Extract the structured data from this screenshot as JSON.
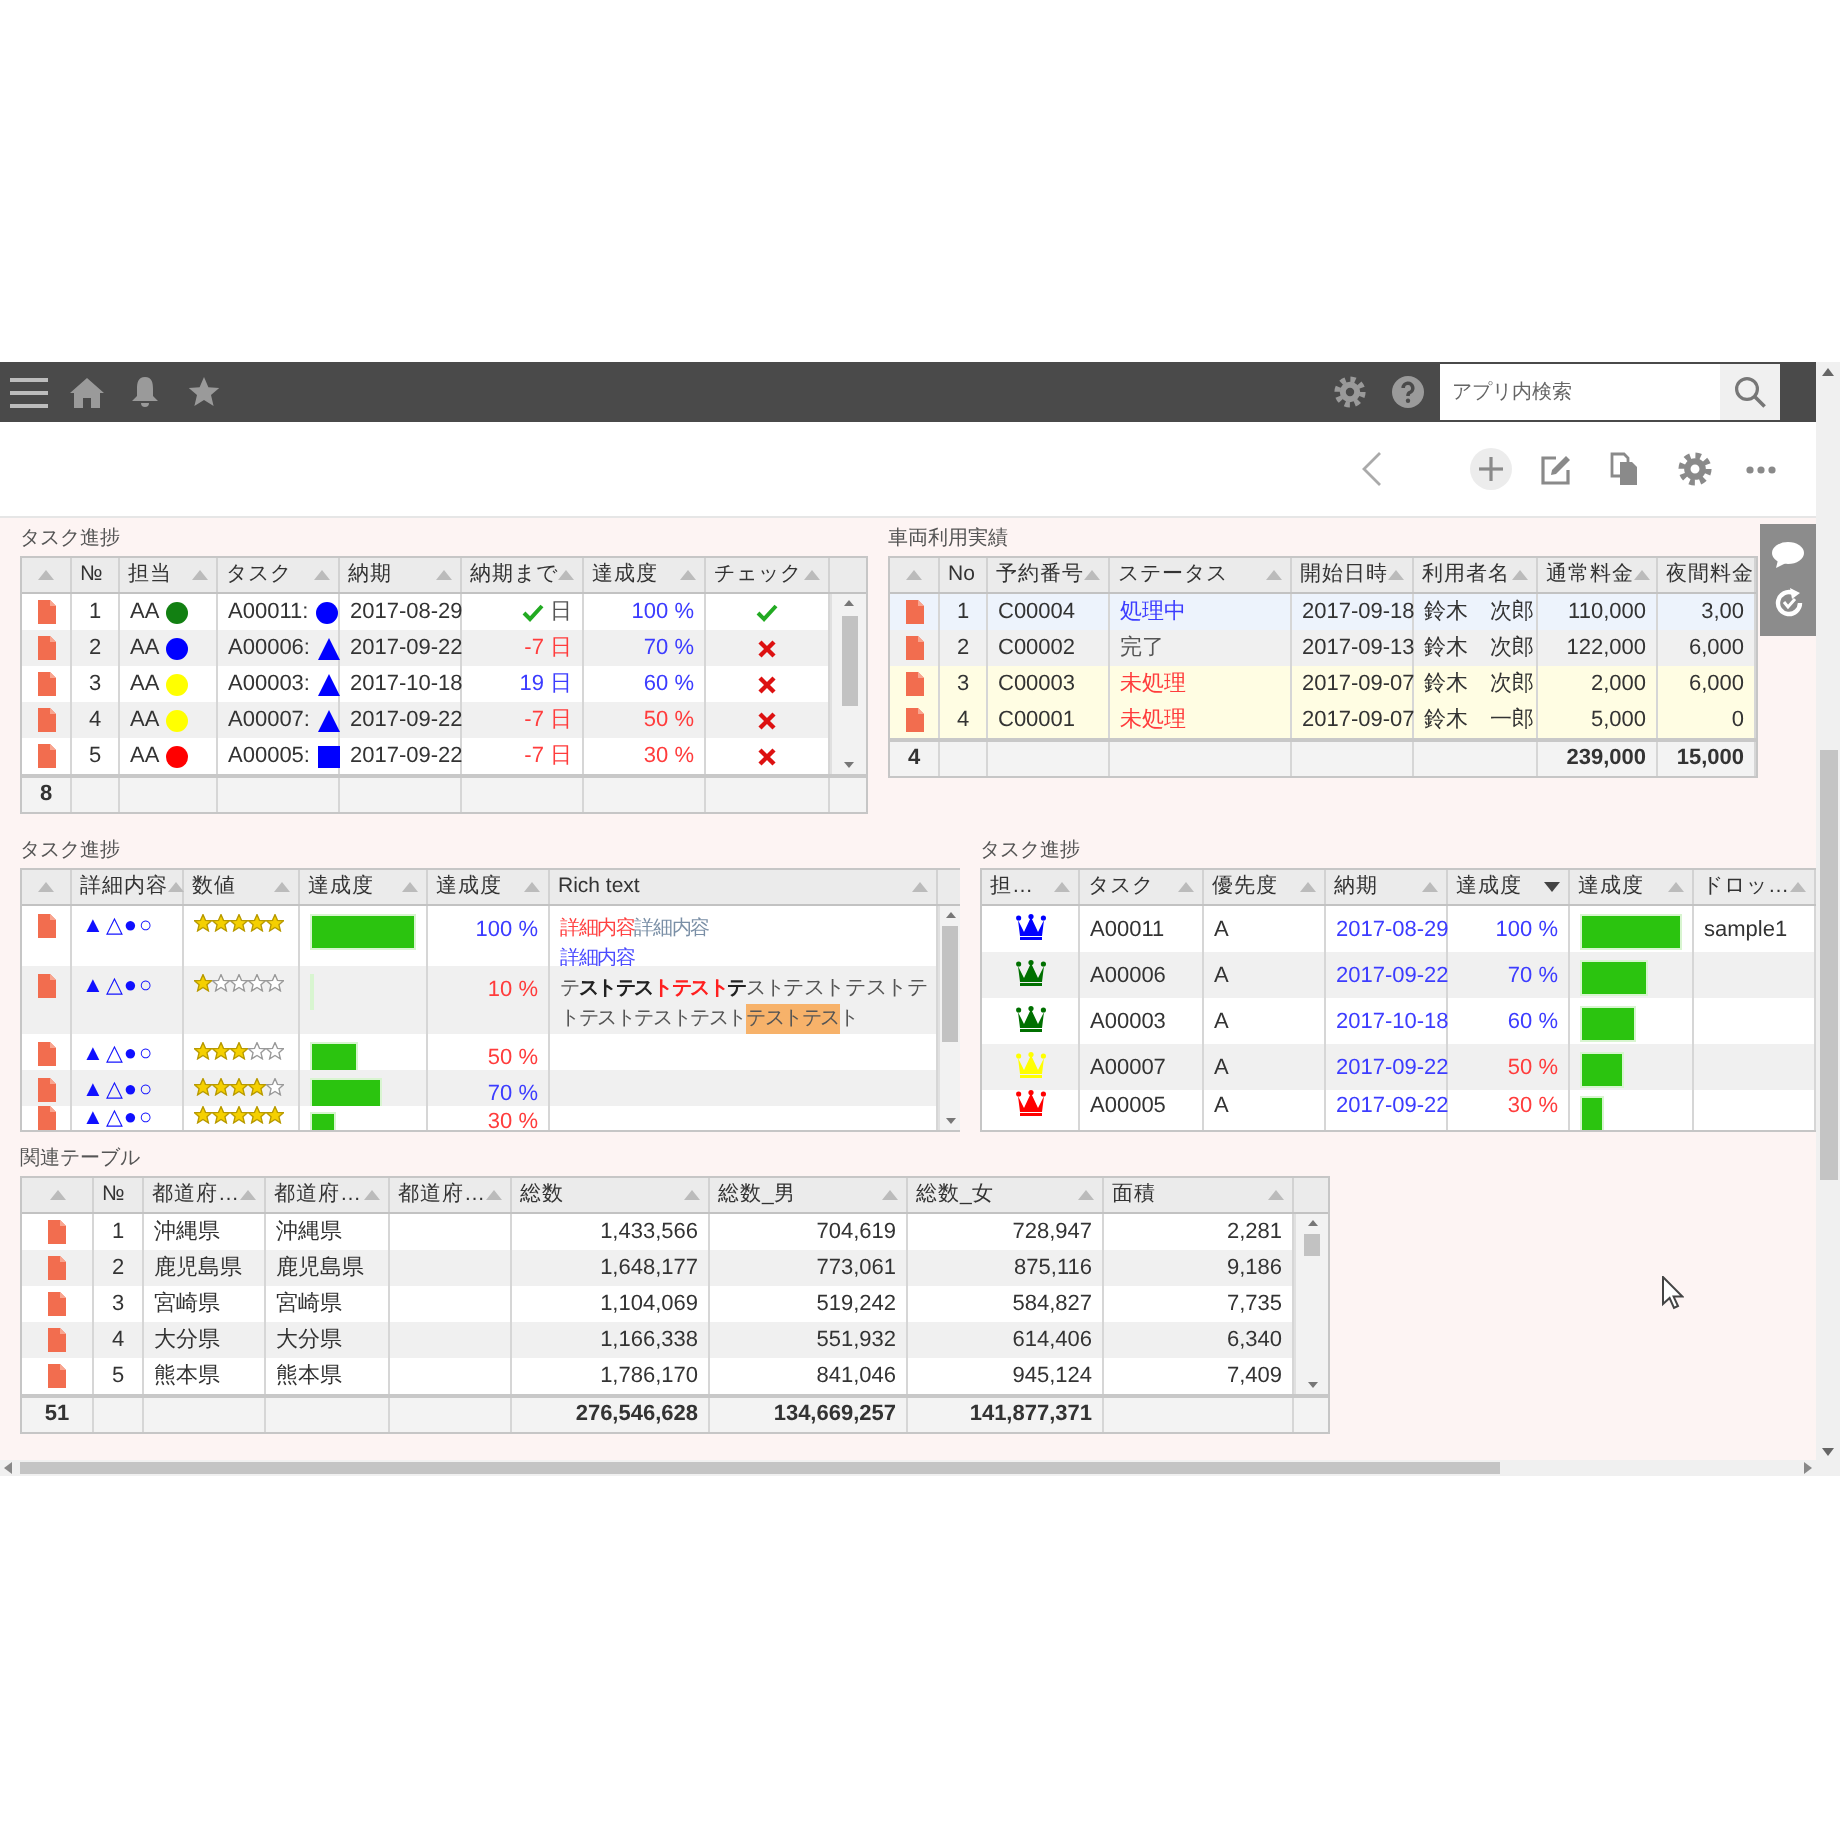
{
  "app_bar": {
    "search": {
      "placeholder": "アプリ内検索"
    }
  },
  "panels": [
    {
      "title": "タスク進捗",
      "footer_count": "8",
      "columns": [
        {
          "sortable": true
        },
        {
          "label": "№",
          "sortable": false
        },
        {
          "label": "担当",
          "sortable": true
        },
        {
          "label": "タスク",
          "sortable": true
        },
        {
          "label": "納期",
          "sortable": true
        },
        {
          "label": "納期まで",
          "sortable": true
        },
        {
          "label": "達成度",
          "sortable": true
        },
        {
          "label": "チェック",
          "sortable": true
        }
      ],
      "rows": [
        {
          "cells": [
            {
              "kind": "doc"
            },
            {
              "kind": "index",
              "text": "1"
            },
            {
              "kind": "assignee",
              "text": "AA",
              "color": "#128012"
            },
            {
              "kind": "task",
              "text": "A00011:",
              "icon": {
                "kind": "circle"
              }
            },
            {
              "kind": "text",
              "text": "2017-08-29"
            },
            {
              "kind": "days",
              "text": "日",
              "met": true
            },
            {
              "kind": "amount",
              "text": "100 %",
              "color": "#3c3cff"
            },
            {
              "kind": "check",
              "checked": true
            }
          ]
        },
        {
          "cells": [
            {
              "kind": "doc"
            },
            {
              "kind": "index",
              "text": "2"
            },
            {
              "kind": "assignee",
              "text": "AA",
              "color": "#0000ff"
            },
            {
              "kind": "task",
              "text": "A00006:",
              "icon": {
                "kind": "triangle"
              }
            },
            {
              "kind": "text",
              "text": "2017-09-22"
            },
            {
              "kind": "days",
              "text": "-7 日",
              "met": false,
              "color": "#ff3c3c"
            },
            {
              "kind": "amount",
              "text": "70 %",
              "color": "#3c3cff"
            },
            {
              "kind": "check",
              "checked": false
            }
          ]
        },
        {
          "cells": [
            {
              "kind": "doc"
            },
            {
              "kind": "index",
              "text": "3"
            },
            {
              "kind": "assignee",
              "text": "AA",
              "color": "#ffff00"
            },
            {
              "kind": "task",
              "text": "A00003:",
              "icon": {
                "kind": "triangle"
              }
            },
            {
              "kind": "text",
              "text": "2017-10-18"
            },
            {
              "kind": "days",
              "text": "19 日",
              "met": false,
              "color": "#3c3cff"
            },
            {
              "kind": "amount",
              "text": "60 %",
              "color": "#3c3cff"
            },
            {
              "kind": "check",
              "checked": false
            }
          ]
        },
        {
          "cells": [
            {
              "kind": "doc"
            },
            {
              "kind": "index",
              "text": "4"
            },
            {
              "kind": "assignee",
              "text": "AA",
              "color": "#ffff00"
            },
            {
              "kind": "task",
              "text": "A00007:",
              "icon": {
                "kind": "triangle"
              }
            },
            {
              "kind": "text",
              "text": "2017-09-22"
            },
            {
              "kind": "days",
              "text": "-7 日",
              "met": false,
              "color": "#ff3c3c"
            },
            {
              "kind": "amount",
              "text": "50 %",
              "color": "#ff3c3c"
            },
            {
              "kind": "check",
              "checked": false
            }
          ]
        },
        {
          "cells": [
            {
              "kind": "doc"
            },
            {
              "kind": "index",
              "text": "5"
            },
            {
              "kind": "assignee",
              "text": "AA",
              "color": "#ff0000"
            },
            {
              "kind": "task",
              "text": "A00005:",
              "icon": {
                "kind": "square"
              }
            },
            {
              "kind": "text",
              "text": "2017-09-22"
            },
            {
              "kind": "days",
              "text": "-7 日",
              "met": false,
              "color": "#ff3c3c"
            },
            {
              "kind": "amount",
              "text": "30 %",
              "color": "#ff3c3c"
            },
            {
              "kind": "check",
              "checked": false
            }
          ]
        }
      ]
    },
    {
      "title": "車両利用実績",
      "footer_count": "4",
      "columns": [
        {
          "sortable": true
        },
        {
          "label": "No",
          "sortable": false
        },
        {
          "label": "予約番号",
          "sortable": true
        },
        {
          "label": "ステータス",
          "sortable": true
        },
        {
          "label": "開始日時",
          "sortable": true
        },
        {
          "label": "利用者名",
          "sortable": true
        },
        {
          "label": "通常料金",
          "sortable": true,
          "total": "239,000"
        },
        {
          "label": "夜間料金",
          "total": "15,000"
        }
      ],
      "rows": [
        {
          "selected": true,
          "cells": [
            {
              "kind": "doc"
            },
            {
              "kind": "index",
              "text": "1"
            },
            {
              "kind": "text",
              "text": "C00004"
            },
            {
              "kind": "text",
              "text": "処理中",
              "color": "#3c3cff"
            },
            {
              "kind": "text",
              "text": "2017-09-18"
            },
            {
              "kind": "text",
              "text": "鈴木　次郎"
            },
            {
              "kind": "amount",
              "text": "110,000"
            },
            {
              "kind": "amount",
              "text": "3,00"
            }
          ]
        },
        {
          "selected": false,
          "cells": [
            {
              "kind": "doc"
            },
            {
              "kind": "index",
              "text": "2"
            },
            {
              "kind": "text",
              "text": "C00002"
            },
            {
              "kind": "text",
              "text": "完了",
              "color": "#555555"
            },
            {
              "kind": "text",
              "text": "2017-09-13"
            },
            {
              "kind": "text",
              "text": "鈴木　次郎"
            },
            {
              "kind": "amount",
              "text": "122,000"
            },
            {
              "kind": "amount",
              "text": "6,000"
            }
          ]
        },
        {
          "selected": false,
          "color": "#fffde3",
          "cells": [
            {
              "kind": "doc"
            },
            {
              "kind": "index",
              "text": "3"
            },
            {
              "kind": "text",
              "text": "C00003"
            },
            {
              "kind": "text",
              "text": "未処理",
              "color": "#ff3c3c"
            },
            {
              "kind": "text",
              "text": "2017-09-07"
            },
            {
              "kind": "text",
              "text": "鈴木　次郎"
            },
            {
              "kind": "amount",
              "text": "2,000"
            },
            {
              "kind": "amount",
              "text": "6,000"
            }
          ]
        },
        {
          "selected": false,
          "color": "#fffde3",
          "cells": [
            {
              "kind": "doc"
            },
            {
              "kind": "index",
              "text": "4"
            },
            {
              "kind": "text",
              "text": "C00001"
            },
            {
              "kind": "text",
              "text": "未処理",
              "color": "#ff3c3c"
            },
            {
              "kind": "text",
              "text": "2017-09-07"
            },
            {
              "kind": "text",
              "text": "鈴木　一郎"
            },
            {
              "kind": "amount",
              "text": "5,000"
            },
            {
              "kind": "amount",
              "text": "0"
            }
          ]
        }
      ]
    },
    {
      "title": "タスク進捗",
      "columns": [
        {
          "sortable": true
        },
        {
          "label": "詳細内容",
          "sortable": true
        },
        {
          "label": "数値",
          "sortable": true
        },
        {
          "label": "達成度",
          "sortable": true
        },
        {
          "label": "達成度",
          "sortable": true
        },
        {
          "label": "Rich text",
          "sortable": true
        }
      ],
      "rows": [
        {
          "cells": [
            {
              "kind": "doc"
            },
            {
              "kind": "glyphs",
              "text": "▲△●○"
            },
            {
              "kind": "stars",
              "stars": 5
            },
            {
              "kind": "bar",
              "level": 1
            },
            {
              "kind": "amount",
              "text": "100 %",
              "color": "#3c3cff"
            },
            {
              "kind": "rich",
              "lines": [
                [
                  {
                    "text": "詳細内容",
                    "color": "#ff4040",
                    "bold": false,
                    "large": false,
                    "highlighted": false
                  },
                  {
                    "text": "詳細内容",
                    "color": "#7a8fa6",
                    "bold": false,
                    "large": false,
                    "highlighted": false
                  }
                ],
                [
                  {
                    "text": "詳細内容",
                    "color": "#4a4aff",
                    "bold": false,
                    "large": false,
                    "highlighted": false
                  }
                ]
              ]
            }
          ]
        },
        {
          "cells": [
            {
              "kind": "doc"
            },
            {
              "kind": "glyphs",
              "text": "▲△●○"
            },
            {
              "kind": "stars",
              "stars": 1
            },
            {
              "kind": "bar",
              "level": 0.02
            },
            {
              "kind": "amount",
              "text": "10 %",
              "color": "#ff3c3c"
            },
            {
              "kind": "rich",
              "lines": [
                [
                  {
                    "text": "テ",
                    "bold": false,
                    "large": false,
                    "highlighted": false
                  },
                  {
                    "text": "ストテス",
                    "color": "#222222",
                    "bold": true,
                    "large": false,
                    "highlighted": false
                  },
                  {
                    "text": "トテスト",
                    "color": "#ff2020",
                    "bold": true,
                    "large": false,
                    "highlighted": false
                  },
                  {
                    "text": "テ",
                    "color": "#222222",
                    "bold": true,
                    "large": false,
                    "highlighted": false
                  },
                  {
                    "text": "スト",
                    "bold": false,
                    "large": false,
                    "highlighted": false
                  },
                  {
                    "text": "テストテストテ",
                    "bold": false,
                    "large": true,
                    "highlighted": false
                  }
                ],
                [
                  {
                    "text": "トテストテストテスト",
                    "bold": false,
                    "large": false,
                    "highlighted": false
                  },
                  {
                    "text": "テストテス",
                    "bold": false,
                    "large": false,
                    "highlighted": true
                  },
                  {
                    "text": "ト",
                    "bold": false,
                    "large": false,
                    "highlighted": false
                  }
                ]
              ]
            }
          ]
        },
        {
          "cells": [
            {
              "kind": "doc"
            },
            {
              "kind": "glyphs",
              "text": "▲△●○"
            },
            {
              "kind": "stars",
              "stars": 3
            },
            {
              "kind": "bar",
              "level": 0.46
            },
            {
              "kind": "amount",
              "text": "50 %",
              "color": "#ff3c3c"
            },
            {
              "kind": "empty"
            }
          ]
        },
        {
          "cells": [
            {
              "kind": "doc"
            },
            {
              "kind": "glyphs",
              "text": "▲△●○"
            },
            {
              "kind": "stars",
              "stars": 4
            },
            {
              "kind": "bar",
              "level": 0.68
            },
            {
              "kind": "amount",
              "text": "70 %",
              "color": "#3c3cff"
            },
            {
              "kind": "empty"
            }
          ]
        },
        {
          "cells": [
            {
              "kind": "doc"
            },
            {
              "kind": "glyphs",
              "text": "▲△●○"
            },
            {
              "kind": "stars",
              "stars": 5
            },
            {
              "kind": "bar",
              "level": 0.24
            },
            {
              "kind": "amount",
              "text": "30 %",
              "color": "#ff3c3c"
            },
            {
              "kind": "empty"
            }
          ]
        }
      ]
    },
    {
      "title": "タスク進捗",
      "columns": [
        {
          "label": "担…",
          "sortable": true,
          "sorted": false
        },
        {
          "label": "タスク",
          "sortable": true,
          "sorted": false
        },
        {
          "label": "優先度",
          "sortable": true,
          "sorted": false
        },
        {
          "label": "納期",
          "sortable": true,
          "sorted": false
        },
        {
          "label": "達成度",
          "sortable": true,
          "sorted": true
        },
        {
          "label": "達成度",
          "sortable": true,
          "sorted": false
        },
        {
          "label": "ドロッ…",
          "sortable": true,
          "sorted": false
        }
      ],
      "rows": [
        {
          "cells": [
            {
              "kind": "crown",
              "color": "#0000ff"
            },
            {
              "kind": "text",
              "text": "A00011"
            },
            {
              "kind": "text",
              "text": "A"
            },
            {
              "kind": "text",
              "text": "2017-08-29",
              "color": "#3c3cff"
            },
            {
              "kind": "amount",
              "text": "100 %",
              "color": "#3c3cff"
            },
            {
              "kind": "bar",
              "level": 1
            },
            {
              "kind": "text",
              "text": "sample1"
            }
          ]
        },
        {
          "cells": [
            {
              "kind": "crown",
              "color": "#007000"
            },
            {
              "kind": "text",
              "text": "A00006"
            },
            {
              "kind": "text",
              "text": "A"
            },
            {
              "kind": "text",
              "text": "2017-09-22",
              "color": "#3c3cff"
            },
            {
              "kind": "amount",
              "text": "70 %",
              "color": "#3c3cff"
            },
            {
              "kind": "bar",
              "level": 0.66
            },
            {
              "kind": "empty"
            }
          ]
        },
        {
          "cells": [
            {
              "kind": "crown",
              "color": "#007000"
            },
            {
              "kind": "text",
              "text": "A00003"
            },
            {
              "kind": "text",
              "text": "A"
            },
            {
              "kind": "text",
              "text": "2017-10-18",
              "color": "#3c3cff"
            },
            {
              "kind": "amount",
              "text": "60 %",
              "color": "#3c3cff"
            },
            {
              "kind": "bar",
              "level": 0.55
            },
            {
              "kind": "empty"
            }
          ]
        },
        {
          "cells": [
            {
              "kind": "crown",
              "color": "#ffff00"
            },
            {
              "kind": "text",
              "text": "A00007"
            },
            {
              "kind": "text",
              "text": "A"
            },
            {
              "kind": "text",
              "text": "2017-09-22",
              "color": "#3c3cff"
            },
            {
              "kind": "amount",
              "text": "50 %",
              "color": "#ff3c3c"
            },
            {
              "kind": "bar",
              "level": 0.44
            },
            {
              "kind": "empty"
            }
          ]
        },
        {
          "cells": [
            {
              "kind": "crown",
              "color": "#ff0000"
            },
            {
              "kind": "text",
              "text": "A00005"
            },
            {
              "kind": "text",
              "text": "A"
            },
            {
              "kind": "text",
              "text": "2017-09-22",
              "color": "#3c3cff"
            },
            {
              "kind": "amount",
              "text": "30 %",
              "color": "#ff3c3c"
            },
            {
              "kind": "bar",
              "level": 0.23
            },
            {
              "kind": "empty"
            }
          ]
        }
      ]
    },
    {
      "title": "関連テーブル",
      "footer_count": "51",
      "columns": [
        {
          "sortable": true
        },
        {
          "label": "№",
          "sortable": false
        },
        {
          "label": "都道府…",
          "sortable": true
        },
        {
          "label": "都道府…",
          "sortable": true
        },
        {
          "label": "都道府…",
          "sortable": true
        },
        {
          "label": "総数",
          "sortable": true,
          "total": "276,546,628"
        },
        {
          "label": "総数_男",
          "sortable": true,
          "total": "134,669,257"
        },
        {
          "label": "総数_女",
          "sortable": true,
          "total": "141,877,371"
        },
        {
          "label": "面積",
          "sortable": true
        }
      ],
      "rows": [
        {
          "cells": [
            {
              "kind": "doc"
            },
            {
              "kind": "index",
              "text": "1"
            },
            {
              "kind": "text",
              "text": "沖縄県"
            },
            {
              "kind": "text",
              "text": "沖縄県"
            },
            {
              "kind": "empty"
            },
            {
              "kind": "amount",
              "text": "1,433,566"
            },
            {
              "kind": "amount",
              "text": "704,619"
            },
            {
              "kind": "amount",
              "text": "728,947"
            },
            {
              "kind": "amount",
              "text": "2,281"
            }
          ]
        },
        {
          "cells": [
            {
              "kind": "doc"
            },
            {
              "kind": "index",
              "text": "2"
            },
            {
              "kind": "text",
              "text": "鹿児島県"
            },
            {
              "kind": "text",
              "text": "鹿児島県"
            },
            {
              "kind": "empty"
            },
            {
              "kind": "amount",
              "text": "1,648,177"
            },
            {
              "kind": "amount",
              "text": "773,061"
            },
            {
              "kind": "amount",
              "text": "875,116"
            },
            {
              "kind": "amount",
              "text": "9,186"
            }
          ]
        },
        {
          "cells": [
            {
              "kind": "doc"
            },
            {
              "kind": "index",
              "text": "3"
            },
            {
              "kind": "text",
              "text": "宮崎県"
            },
            {
              "kind": "text",
              "text": "宮崎県"
            },
            {
              "kind": "empty"
            },
            {
              "kind": "amount",
              "text": "1,104,069"
            },
            {
              "kind": "amount",
              "text": "519,242"
            },
            {
              "kind": "amount",
              "text": "584,827"
            },
            {
              "kind": "amount",
              "text": "7,735"
            }
          ]
        },
        {
          "cells": [
            {
              "kind": "doc"
            },
            {
              "kind": "index",
              "text": "4"
            },
            {
              "kind": "text",
              "text": "大分県"
            },
            {
              "kind": "text",
              "text": "大分県"
            },
            {
              "kind": "empty"
            },
            {
              "kind": "amount",
              "text": "1,166,338"
            },
            {
              "kind": "amount",
              "text": "551,932"
            },
            {
              "kind": "amount",
              "text": "614,406"
            },
            {
              "kind": "amount",
              "text": "6,340"
            }
          ]
        },
        {
          "cells": [
            {
              "kind": "doc"
            },
            {
              "kind": "index",
              "text": "5"
            },
            {
              "kind": "text",
              "text": "熊本県"
            },
            {
              "kind": "text",
              "text": "熊本県"
            },
            {
              "kind": "empty"
            },
            {
              "kind": "amount",
              "text": "1,786,170"
            },
            {
              "kind": "amount",
              "text": "841,046"
            },
            {
              "kind": "amount",
              "text": "945,124"
            },
            {
              "kind": "amount",
              "text": "7,409"
            }
          ]
        }
      ]
    }
  ]
}
